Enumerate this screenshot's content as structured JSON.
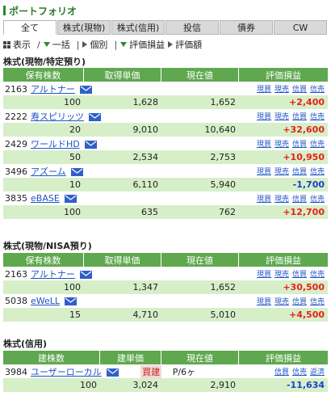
{
  "title": "ポートフォリオ",
  "tabs": [
    {
      "label": "全て"
    },
    {
      "label": "株式(現物)"
    },
    {
      "label": "株式(信用)"
    },
    {
      "label": "投信"
    },
    {
      "label": "債券"
    },
    {
      "label": "CW"
    }
  ],
  "toolbar": {
    "display": "表示",
    "bulk": "一括",
    "individual": "個別",
    "pl_label": "評価損益",
    "value_label": "評価額"
  },
  "actions": {
    "buy": "現買",
    "sell": "現売",
    "margin_buy": "信買",
    "margin_sell": "信売",
    "repay": "返済"
  },
  "sections": [
    {
      "title": "株式(現物/特定預り)",
      "headers": [
        "保有株数",
        "取得単価",
        "現在値",
        "評価損益"
      ],
      "rows": [
        {
          "code": "2163",
          "name": "アルトナー",
          "qty": "100",
          "cost": "1,628",
          "price": "1,652",
          "pl": "+2,400"
        },
        {
          "code": "2222",
          "name": "寿スピリッツ",
          "qty": "20",
          "cost": "9,010",
          "price": "10,640",
          "pl": "+32,600"
        },
        {
          "code": "2429",
          "name": "ワールドHD",
          "qty": "50",
          "cost": "2,534",
          "price": "2,753",
          "pl": "+10,950"
        },
        {
          "code": "3496",
          "name": "アズーム",
          "qty": "10",
          "cost": "6,110",
          "price": "5,940",
          "pl": "-1,700"
        },
        {
          "code": "3835",
          "name": "eBASE",
          "qty": "100",
          "cost": "635",
          "price": "762",
          "pl": "+12,700"
        }
      ]
    },
    {
      "title": "株式(現物/NISA預り)",
      "headers": [
        "保有株数",
        "取得単価",
        "現在値",
        "評価損益"
      ],
      "rows": [
        {
          "code": "2163",
          "name": "アルトナー",
          "qty": "100",
          "cost": "1,347",
          "price": "1,652",
          "pl": "+30,500"
        },
        {
          "code": "5038",
          "name": "eWeLL",
          "qty": "15",
          "cost": "4,710",
          "price": "5,010",
          "pl": "+4,500"
        }
      ]
    },
    {
      "title": "株式(信用)",
      "headers": [
        "建株数",
        "建単価",
        "現在値",
        "評価損益"
      ],
      "rows": [
        {
          "code": "3984",
          "name": "ユーザーローカル",
          "side": "買建",
          "term": "P/6ヶ",
          "qty": "100",
          "cost": "3,024",
          "price": "2,910",
          "pl": "-11,634"
        }
      ]
    }
  ],
  "colors": {
    "header_green": "#5fa84f",
    "row_green": "#d6efc9",
    "profit": "#e8201a",
    "loss": "#1c3ec8",
    "link": "#1f54c4"
  }
}
